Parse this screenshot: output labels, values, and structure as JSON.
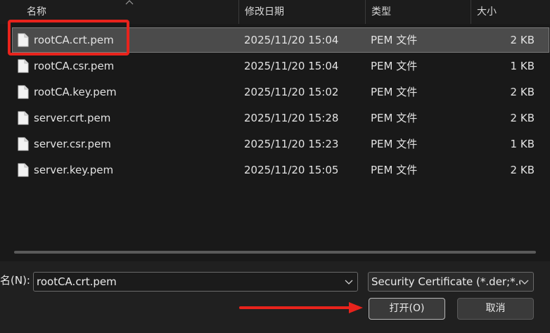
{
  "header": {
    "name": "名称",
    "date": "修改日期",
    "type": "类型",
    "size": "大小"
  },
  "files": [
    {
      "name": "rootCA.crt.pem",
      "date": "2025/11/20 15:04",
      "type": "PEM 文件",
      "size": "2 KB",
      "selected": true
    },
    {
      "name": "rootCA.csr.pem",
      "date": "2025/11/20 15:04",
      "type": "PEM 文件",
      "size": "1 KB"
    },
    {
      "name": "rootCA.key.pem",
      "date": "2025/11/20 15:02",
      "type": "PEM 文件",
      "size": "2 KB"
    },
    {
      "name": "server.crt.pem",
      "date": "2025/11/20 15:28",
      "type": "PEM 文件",
      "size": "2 KB"
    },
    {
      "name": "server.csr.pem",
      "date": "2025/11/20 15:23",
      "type": "PEM 文件",
      "size": "1 KB"
    },
    {
      "name": "server.key.pem",
      "date": "2025/11/20 15:05",
      "type": "PEM 文件",
      "size": "2 KB"
    }
  ],
  "bottom": {
    "filename_label": "名(N):",
    "filename_value": "rootCA.crt.pem",
    "filetype_value": "Security Certificate (*.der;*.c",
    "open_label": "打开(O)",
    "cancel_label": "取消"
  },
  "icons": {
    "file": "document-icon",
    "sort": "chevron-up-icon",
    "dropdown": "chevron-down-icon"
  },
  "colors": {
    "background": "#191919",
    "selected_row": "#4b4b4b",
    "annotation_red": "#e8231c"
  }
}
